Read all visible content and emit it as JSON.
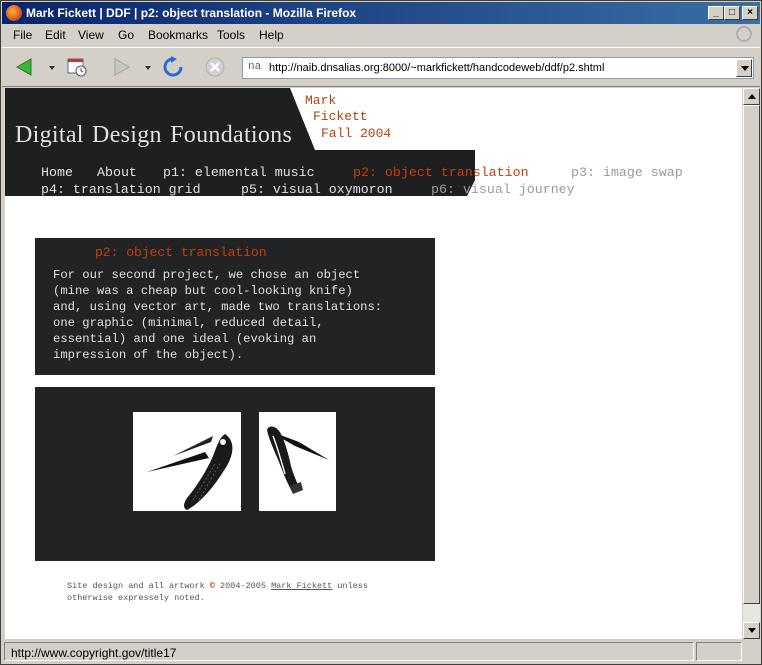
{
  "window": {
    "title": "Mark Fickett | DDF | p2: object translation - Mozilla Firefox",
    "controls": {
      "minimize": "_",
      "maximize": "□",
      "close": "×"
    }
  },
  "menu": [
    "File",
    "Edit",
    "View",
    "Go",
    "Bookmarks",
    "Tools",
    "Help"
  ],
  "toolbar": {
    "site_icon": "na",
    "url": "http://naib.dnsalias.org:8000/~markfickett/handcodeweb/ddf/p2.shtml",
    "icons": [
      "back-arrow-icon",
      "history-icon",
      "forward-arrow-icon",
      "reload-icon",
      "stop-icon"
    ]
  },
  "page": {
    "site_title": "Digital Design Foundations",
    "author_lines": [
      "Mark",
      "Fickett",
      "Fall 2004"
    ],
    "nav": {
      "home": "Home",
      "about": "About",
      "p1": "p1: elemental music",
      "p2": "p2: object translation",
      "p3": "p3: image swap",
      "p4": "p4: translation grid",
      "p5": "p5: visual oxymoron",
      "p6": "p6: visual journey"
    },
    "panel": {
      "heading": "p2: object translation",
      "lines": [
        "For our second project, we chose an object",
        "(mine was a cheap but cool-looking knife)",
        "and, using vector art, made two translations:",
        "one graphic (minimal, reduced detail,",
        "essential) and one ideal (evoking an",
        "impression of the object)."
      ]
    },
    "footer": {
      "prefix": "Site design and all artwork",
      "copyright_symbol": "©",
      "years": " 2004-2005 ",
      "author": "Mark Fickett",
      "suffix": " unless",
      "line2": "otherwise expressely noted."
    }
  },
  "status": {
    "text": "http://www.copyright.gov/title17"
  },
  "colors": {
    "accent": "#c83d0f",
    "author": "#b3420f",
    "panel": "#222324",
    "header": "#1e1f20"
  }
}
